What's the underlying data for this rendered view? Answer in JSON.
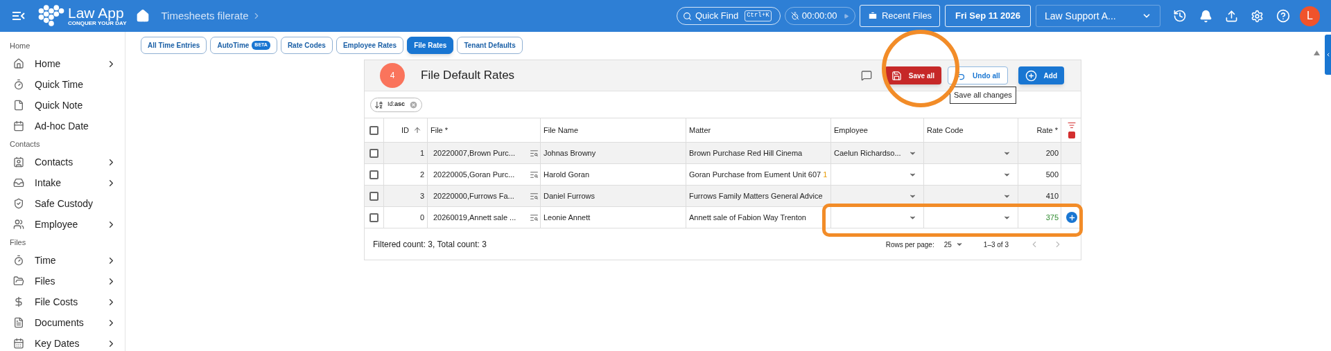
{
  "topbar": {
    "brand": "Law App",
    "tagline": "CONQUER YOUR DAY",
    "breadcrumb": "Timesheets filerate",
    "quick_find": "Quick Find",
    "shortcut": "Ctrl+K",
    "timer": "00:00:00",
    "recent_files": "Recent Files",
    "date": "Fri Sep 11 2026",
    "tenant": "Law Support A...",
    "avatar": "L"
  },
  "sidebar": {
    "sections": [
      {
        "title": "Home",
        "items": [
          {
            "label": "Home",
            "has_submenu": true
          },
          {
            "label": "Quick Time",
            "has_submenu": false
          },
          {
            "label": "Quick Note",
            "has_submenu": false
          },
          {
            "label": "Ad-hoc Date",
            "has_submenu": false
          }
        ]
      },
      {
        "title": "Contacts",
        "items": [
          {
            "label": "Contacts",
            "has_submenu": true
          },
          {
            "label": "Intake",
            "has_submenu": true
          },
          {
            "label": "Safe Custody",
            "has_submenu": false
          },
          {
            "label": "Employee",
            "has_submenu": true
          }
        ]
      },
      {
        "title": "Files",
        "items": [
          {
            "label": "Time",
            "has_submenu": true
          },
          {
            "label": "Files",
            "has_submenu": true
          },
          {
            "label": "File Costs",
            "has_submenu": true
          },
          {
            "label": "Documents",
            "has_submenu": true
          },
          {
            "label": "Key Dates",
            "has_submenu": true
          }
        ]
      }
    ]
  },
  "tabs": [
    {
      "label": "All Time Entries",
      "selected": false
    },
    {
      "label": "AutoTime",
      "badge": "BETA",
      "selected": false
    },
    {
      "label": "Rate Codes",
      "selected": false
    },
    {
      "label": "Employee Rates",
      "selected": false
    },
    {
      "label": "File Rates",
      "selected": true
    },
    {
      "label": "Tenant Defaults",
      "selected": false
    }
  ],
  "panel": {
    "step": "4",
    "title": "File Default Rates",
    "buttons": [
      {
        "label": "Save all",
        "kind": "save"
      },
      {
        "label": "Undo all",
        "kind": "undo"
      },
      {
        "label": "Add",
        "kind": "add"
      }
    ],
    "tooltip": "Save all changes",
    "sort_chip": "Id:**asc**",
    "select_all_checked": false,
    "columns": [
      "ID",
      "File *",
      "File Name",
      "Matter",
      "Employee",
      "Rate Code",
      "Rate *"
    ],
    "rows": [
      {
        "checked": false,
        "id": "1",
        "file": "20220007,Brown Purc...",
        "file_name": "Johnas Browny",
        "matter": "Brown Purchase Red Hill Cinema",
        "employee": "Caelun Richardso...",
        "rate": "200",
        "edited": false
      },
      {
        "checked": false,
        "id": "2",
        "file": "20220005,Goran Purc...",
        "file_name": "Harold Goran",
        "matter": "Goran Purchase from Eument Unit 607",
        "matter_flag": "1",
        "rate": "500",
        "edited": false
      },
      {
        "checked": false,
        "id": "3",
        "file": "20220000,Furrows Fa...",
        "file_name": "Daniel Furrows",
        "matter": "Furrows Family Matters General Advice",
        "rate": "410",
        "edited": false
      },
      {
        "checked": false,
        "id": "0",
        "file": "20260019,Annett sale ...",
        "file_name": "Leonie Annett",
        "matter": "Annett sale of Fabion Way Trenton",
        "rate": "375",
        "edited": true
      }
    ],
    "footer": {
      "count": "Filtered count: 3, Total count: 3",
      "rows_per_page": "Rows per page:",
      "page_size": "25",
      "range": "1–3 of 3",
      "prev_disabled": true,
      "next_disabled": true
    }
  }
}
